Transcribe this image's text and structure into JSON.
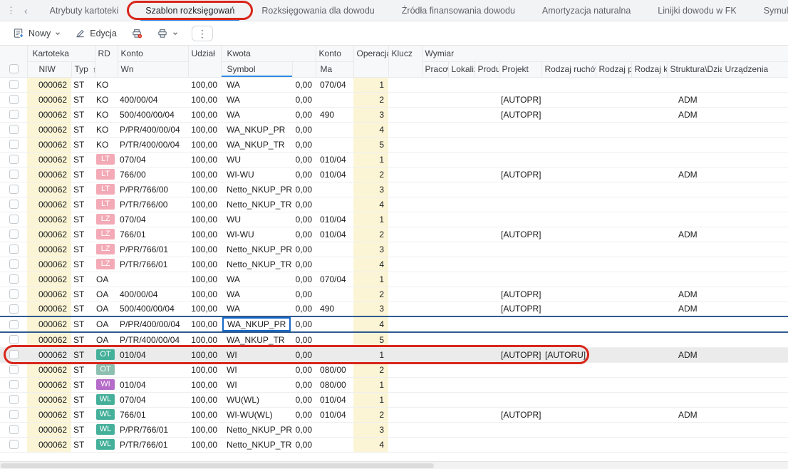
{
  "tab_bar": {
    "tabs": [
      {
        "label": "Atrybuty kartoteki",
        "selected": false,
        "annotated": false
      },
      {
        "label": "Szablon rozksięgowań",
        "selected": true,
        "annotated": true
      },
      {
        "label": "Rozksięgowania dla dowodu",
        "selected": false,
        "annotated": false
      },
      {
        "label": "Źródła finansowania dowodu",
        "selected": false,
        "annotated": false
      },
      {
        "label": "Amortyzacja naturalna",
        "selected": false,
        "annotated": false
      },
      {
        "label": "Linijki dowodu w FK",
        "selected": false,
        "annotated": false
      },
      {
        "label": "Symulacja dowodu w FK",
        "selected": false,
        "annotated": false
      }
    ]
  },
  "toolbar": {
    "new_label": "Nowy",
    "edit_label": "Edycja"
  },
  "table": {
    "group_headers": {
      "kartoteka": "Kartoteka",
      "rd": "RD",
      "konto_wn": "Konto",
      "udzial": "Udział",
      "kwota": "Kwota",
      "konto_ma": "Konto",
      "operacja": "Operacja",
      "klucz": "Klucz",
      "wymiar": "Wymiar"
    },
    "sub_headers": {
      "niw": "NIW",
      "typ": "Typ",
      "sort_arrow": "↑",
      "wn": "Wn",
      "symbol": "Symbol",
      "ma": "Ma",
      "pracownik": "Pracow",
      "lokalizacja": "Lokaliz",
      "produkt": "Produ",
      "projekt": "Projekt",
      "rodzaj_ruchow": "Rodzaj ruchów",
      "rodzaj_p": "Rodzaj p",
      "rodzaj_kc": "Rodzaj kc",
      "struktura": "Struktura\\Działy",
      "urzadzenia": "Urządzenia"
    },
    "rows": [
      {
        "niw": "000062",
        "typ": "ST",
        "rd": "KO",
        "rd_style": "plain",
        "wn": "",
        "udzial": "100,00",
        "symbol": "WA",
        "kwota": "0,00",
        "ma": "070/04",
        "op": "1",
        "projekt": "",
        "rr": "",
        "str": ""
      },
      {
        "niw": "000062",
        "typ": "ST",
        "rd": "KO",
        "rd_style": "plain",
        "wn": "400/00/04",
        "udzial": "100,00",
        "symbol": "WA",
        "kwota": "0,00",
        "ma": "",
        "op": "2",
        "projekt": "[AUTOPR]",
        "rr": "",
        "str": "ADM"
      },
      {
        "niw": "000062",
        "typ": "ST",
        "rd": "KO",
        "rd_style": "plain",
        "wn": "500/400/00/04",
        "udzial": "100,00",
        "symbol": "WA",
        "kwota": "0,00",
        "ma": "490",
        "op": "3",
        "projekt": "[AUTOPR]",
        "rr": "",
        "str": "ADM"
      },
      {
        "niw": "000062",
        "typ": "ST",
        "rd": "KO",
        "rd_style": "plain",
        "wn": "P/PR/400/00/04",
        "udzial": "100,00",
        "symbol": "WA_NKUP_PR",
        "kwota": "0,00",
        "ma": "",
        "op": "4",
        "projekt": "",
        "rr": "",
        "str": ""
      },
      {
        "niw": "000062",
        "typ": "ST",
        "rd": "KO",
        "rd_style": "plain",
        "wn": "P/TR/400/00/04",
        "udzial": "100,00",
        "symbol": "WA_NKUP_TR",
        "kwota": "0,00",
        "ma": "",
        "op": "5",
        "projekt": "",
        "rr": "",
        "str": ""
      },
      {
        "niw": "000062",
        "typ": "ST",
        "rd": "LT",
        "rd_style": "pink",
        "wn": "070/04",
        "udzial": "100,00",
        "symbol": "WU",
        "kwota": "0,00",
        "ma": "010/04",
        "op": "1",
        "projekt": "",
        "rr": "",
        "str": ""
      },
      {
        "niw": "000062",
        "typ": "ST",
        "rd": "LT",
        "rd_style": "pink",
        "wn": "766/00",
        "udzial": "100,00",
        "symbol": "WI-WU",
        "kwota": "0,00",
        "ma": "010/04",
        "op": "2",
        "projekt": "[AUTOPR]",
        "rr": "",
        "str": "ADM"
      },
      {
        "niw": "000062",
        "typ": "ST",
        "rd": "LT",
        "rd_style": "pink",
        "wn": "P/PR/766/00",
        "udzial": "100,00",
        "symbol": "Netto_NKUP_PR",
        "kwota": "0,00",
        "ma": "",
        "op": "3",
        "projekt": "",
        "rr": "",
        "str": ""
      },
      {
        "niw": "000062",
        "typ": "ST",
        "rd": "LT",
        "rd_style": "pink",
        "wn": "P/TR/766/00",
        "udzial": "100,00",
        "symbol": "Netto_NKUP_TR",
        "kwota": "0,00",
        "ma": "",
        "op": "4",
        "projekt": "",
        "rr": "",
        "str": ""
      },
      {
        "niw": "000062",
        "typ": "ST",
        "rd": "LZ",
        "rd_style": "pink",
        "wn": "070/04",
        "udzial": "100,00",
        "symbol": "WU",
        "kwota": "0,00",
        "ma": "010/04",
        "op": "1",
        "projekt": "",
        "rr": "",
        "str": ""
      },
      {
        "niw": "000062",
        "typ": "ST",
        "rd": "LZ",
        "rd_style": "pink",
        "wn": "766/01",
        "udzial": "100,00",
        "symbol": "WI-WU",
        "kwota": "0,00",
        "ma": "010/04",
        "op": "2",
        "projekt": "[AUTOPR]",
        "rr": "",
        "str": "ADM"
      },
      {
        "niw": "000062",
        "typ": "ST",
        "rd": "LZ",
        "rd_style": "pink",
        "wn": "P/PR/766/01",
        "udzial": "100,00",
        "symbol": "Netto_NKUP_PR",
        "kwota": "0,00",
        "ma": "",
        "op": "3",
        "projekt": "",
        "rr": "",
        "str": ""
      },
      {
        "niw": "000062",
        "typ": "ST",
        "rd": "LZ",
        "rd_style": "pink",
        "wn": "P/TR/766/01",
        "udzial": "100,00",
        "symbol": "Netto_NKUP_TR",
        "kwota": "0,00",
        "ma": "",
        "op": "4",
        "projekt": "",
        "rr": "",
        "str": ""
      },
      {
        "niw": "000062",
        "typ": "ST",
        "rd": "OA",
        "rd_style": "plain",
        "wn": "",
        "udzial": "100,00",
        "symbol": "WA",
        "kwota": "0,00",
        "ma": "070/04",
        "op": "1",
        "projekt": "",
        "rr": "",
        "str": ""
      },
      {
        "niw": "000062",
        "typ": "ST",
        "rd": "OA",
        "rd_style": "plain",
        "wn": "400/00/04",
        "udzial": "100,00",
        "symbol": "WA",
        "kwota": "0,00",
        "ma": "",
        "op": "2",
        "projekt": "[AUTOPR]",
        "rr": "",
        "str": "ADM"
      },
      {
        "niw": "000062",
        "typ": "ST",
        "rd": "OA",
        "rd_style": "plain",
        "wn": "500/400/00/04",
        "udzial": "100,00",
        "symbol": "WA",
        "kwota": "0,00",
        "ma": "490",
        "op": "3",
        "projekt": "[AUTOPR]",
        "rr": "",
        "str": "ADM"
      },
      {
        "niw": "000062",
        "typ": "ST",
        "rd": "OA",
        "rd_style": "plain",
        "wn": "P/PR/400/00/04",
        "udzial": "100,00",
        "symbol": "WA_NKUP_PR",
        "kwota": "0,00",
        "ma": "",
        "op": "4",
        "projekt": "",
        "rr": "",
        "str": "",
        "current": true
      },
      {
        "niw": "000062",
        "typ": "ST",
        "rd": "OA",
        "rd_style": "plain",
        "wn": "P/TR/400/00/04",
        "udzial": "100,00",
        "symbol": "WA_NKUP_TR",
        "kwota": "0,00",
        "ma": "",
        "op": "5",
        "projekt": "",
        "rr": "",
        "str": ""
      },
      {
        "niw": "000062",
        "typ": "ST",
        "rd": "OT",
        "rd_style": "teal",
        "wn": "010/04",
        "udzial": "100,00",
        "symbol": "WI",
        "kwota": "0,00",
        "ma": "",
        "op": "1",
        "projekt": "[AUTOPR]",
        "rr": "[AUTORU]",
        "str": "ADM",
        "highlighted": true
      },
      {
        "niw": "000062",
        "typ": "ST",
        "rd": "OT",
        "rd_style": "teal-light",
        "wn": "",
        "udzial": "100,00",
        "symbol": "WI",
        "kwota": "0,00",
        "ma": "080/00",
        "op": "2",
        "projekt": "",
        "rr": "",
        "str": ""
      },
      {
        "niw": "000062",
        "typ": "ST",
        "rd": "WI",
        "rd_style": "purple",
        "wn": "010/04",
        "udzial": "100,00",
        "symbol": "WI",
        "kwota": "0,00",
        "ma": "080/00",
        "op": "1",
        "projekt": "",
        "rr": "",
        "str": ""
      },
      {
        "niw": "000062",
        "typ": "ST",
        "rd": "WL",
        "rd_style": "teal",
        "wn": "070/04",
        "udzial": "100,00",
        "symbol": "WU(WL)",
        "kwota": "0,00",
        "ma": "010/04",
        "op": "1",
        "projekt": "",
        "rr": "",
        "str": ""
      },
      {
        "niw": "000062",
        "typ": "ST",
        "rd": "WL",
        "rd_style": "teal",
        "wn": "766/01",
        "udzial": "100,00",
        "symbol": "WI-WU(WL)",
        "kwota": "0,00",
        "ma": "010/04",
        "op": "2",
        "projekt": "[AUTOPR]",
        "rr": "",
        "str": "ADM"
      },
      {
        "niw": "000062",
        "typ": "ST",
        "rd": "WL",
        "rd_style": "teal",
        "wn": "P/PR/766/01",
        "udzial": "100,00",
        "symbol": "Netto_NKUP_PR",
        "kwota": "0,00",
        "ma": "",
        "op": "3",
        "projekt": "",
        "rr": "",
        "str": ""
      },
      {
        "niw": "000062",
        "typ": "ST",
        "rd": "WL",
        "rd_style": "teal",
        "wn": "P/TR/766/01",
        "udzial": "100,00",
        "symbol": "Netto_NKUP_TR",
        "kwota": "0,00",
        "ma": "",
        "op": "4",
        "projekt": "",
        "rr": "",
        "str": ""
      }
    ]
  },
  "colors": {
    "accent_blue": "#2b7cd9",
    "annotation_red": "#d9261c",
    "badge_pink": "#f3aab6",
    "badge_teal": "#45b09a",
    "badge_teal_light": "#8ec0b1",
    "badge_purple": "#b56bc8",
    "column_yellow": "#fbf5d6",
    "highlight_gray": "#ebebeb"
  }
}
